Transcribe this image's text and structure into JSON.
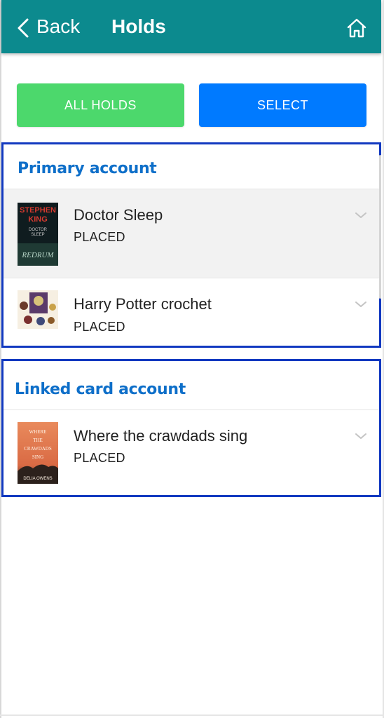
{
  "header": {
    "back_label": "Back",
    "title": "Holds",
    "icons": {
      "back": "chevron-left-icon",
      "home": "home-icon"
    },
    "color": "#0c8a8e"
  },
  "buttons": {
    "all_holds": "ALL HOLDS",
    "select": "SELECT",
    "all_holds_color": "#4cd86c",
    "select_color": "#007aff"
  },
  "sections": [
    {
      "title": "Primary account",
      "items": [
        {
          "title": "Doctor Sleep",
          "status": "PLACED",
          "cover_author": "STEPHEN KING",
          "cover_title": "DOCTOR SLEEP",
          "cover_tag": "REDRUM"
        },
        {
          "title": "Harry Potter crochet",
          "status": "PLACED"
        }
      ]
    },
    {
      "title": "Linked card account",
      "items": [
        {
          "title": "Where the crawdads sing",
          "status": "PLACED",
          "cover_lines": [
            "WHERE",
            "THE",
            "CRAWDADS",
            "SING"
          ],
          "cover_author": "DELIA OWENS"
        }
      ]
    }
  ],
  "accent_colors": {
    "section_title": "#0e6fc9",
    "section_border": "#1239c0"
  }
}
